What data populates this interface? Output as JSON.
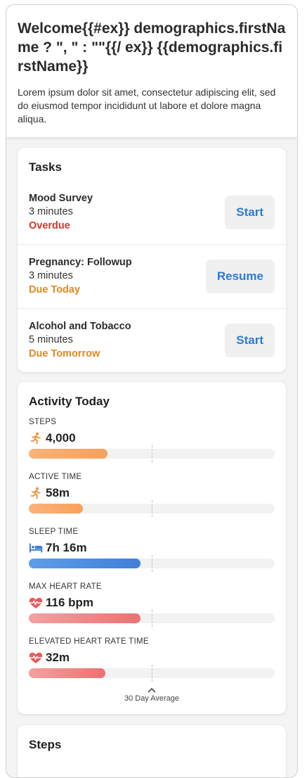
{
  "header": {
    "welcome": "Welcome{{#ex}} demographics.firstName ? \", \" : \"\"{{/ ex}} {{demographics.firstName}}",
    "intro": "Lorem ipsum dolor sit amet, consectetur adipiscing elit, sed do eiusmod tempor incididunt ut labore et dolore magna aliqua."
  },
  "tasks": {
    "title": "Tasks",
    "items": [
      {
        "name": "Mood Survey",
        "duration": "3 minutes",
        "due": "Overdue",
        "due_color": "#d9342b",
        "button": "Start"
      },
      {
        "name": "Pregnancy: Followup",
        "duration": "3 minutes",
        "due": "Due Today",
        "due_color": "#e0891e",
        "button": "Resume"
      },
      {
        "name": "Alcohol and Tobacco",
        "duration": "5 minutes",
        "due": "Due Tomorrow",
        "due_color": "#e0891e",
        "button": "Start"
      }
    ]
  },
  "activity": {
    "title": "Activity Today",
    "average_fraction": 0.5,
    "metrics": [
      {
        "label": "STEPS",
        "value": "4,000",
        "icon": "running-icon",
        "fill_fraction": 0.32,
        "color_from": "#fbb27a",
        "color_to": "#f7a15c"
      },
      {
        "label": "ACTIVE TIME",
        "value": "58m",
        "icon": "running-icon",
        "fill_fraction": 0.22,
        "color_from": "#fbb27a",
        "color_to": "#f7a15c"
      },
      {
        "label": "SLEEP TIME",
        "value": "7h 16m",
        "icon": "bed-icon",
        "fill_fraction": 0.455,
        "color_from": "#5e9de8",
        "color_to": "#3f7fd8"
      },
      {
        "label": "MAX HEART RATE",
        "value": "116 bpm",
        "icon": "heartbeat-icon",
        "fill_fraction": 0.455,
        "color_from": "#f4a0a0",
        "color_to": "#ea7272"
      },
      {
        "label": "ELEVATED HEART RATE TIME",
        "value": "32m",
        "icon": "heartbeat-icon",
        "fill_fraction": 0.31,
        "color_from": "#f4a0a0",
        "color_to": "#ea7272"
      }
    ],
    "toggle_label": "30 Day Average"
  },
  "steps": {
    "title": "Steps"
  }
}
